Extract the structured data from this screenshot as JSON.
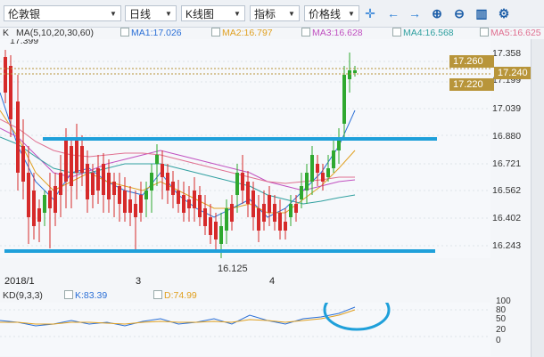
{
  "toolbar": {
    "symbol": "伦敦银",
    "period": "日线",
    "chart_type": "K线图",
    "indicator": "指标",
    "price_line": "价格线",
    "icons": [
      "crosshair-icon",
      "move-left-icon",
      "move-right-icon",
      "zoom-in-icon",
      "zoom-out-icon",
      "bar-chart-icon",
      "settings-icon"
    ]
  },
  "legend": {
    "k_label": "K",
    "ma_params": "MA(5,10,20,30,60)",
    "ma1": "MA1:17.026",
    "ma2": "MA2:16.797",
    "ma3": "MA3:16.628",
    "ma4": "MA4:16.568",
    "ma5": "MA5:16.625",
    "high_note": "17.399",
    "low_note": "16.125"
  },
  "price_axis": [
    "17.358",
    "17.199",
    "17.039",
    "16.880",
    "16.721",
    "16.562",
    "16.402",
    "16.243"
  ],
  "price_boxes": [
    "17.260",
    "17.240",
    "17.220"
  ],
  "x_axis": [
    "2018/1",
    "3",
    "4"
  ],
  "kd": {
    "label": "KD(9,3,3)",
    "k": "K:83.39",
    "d": "D:74.99",
    "axis": [
      "100",
      "80",
      "50",
      "20",
      "0"
    ]
  },
  "colors": {
    "up": "#2fa82f",
    "down": "#d62a2a",
    "support_line": "#1fa0da",
    "ma1": "#2b6fd6",
    "ma2": "#e0a020",
    "ma3": "#c050c0",
    "ma4": "#30a0a0",
    "ma5": "#e07090",
    "box": "#b8953a",
    "ellipse": "#1fa0da"
  }
}
